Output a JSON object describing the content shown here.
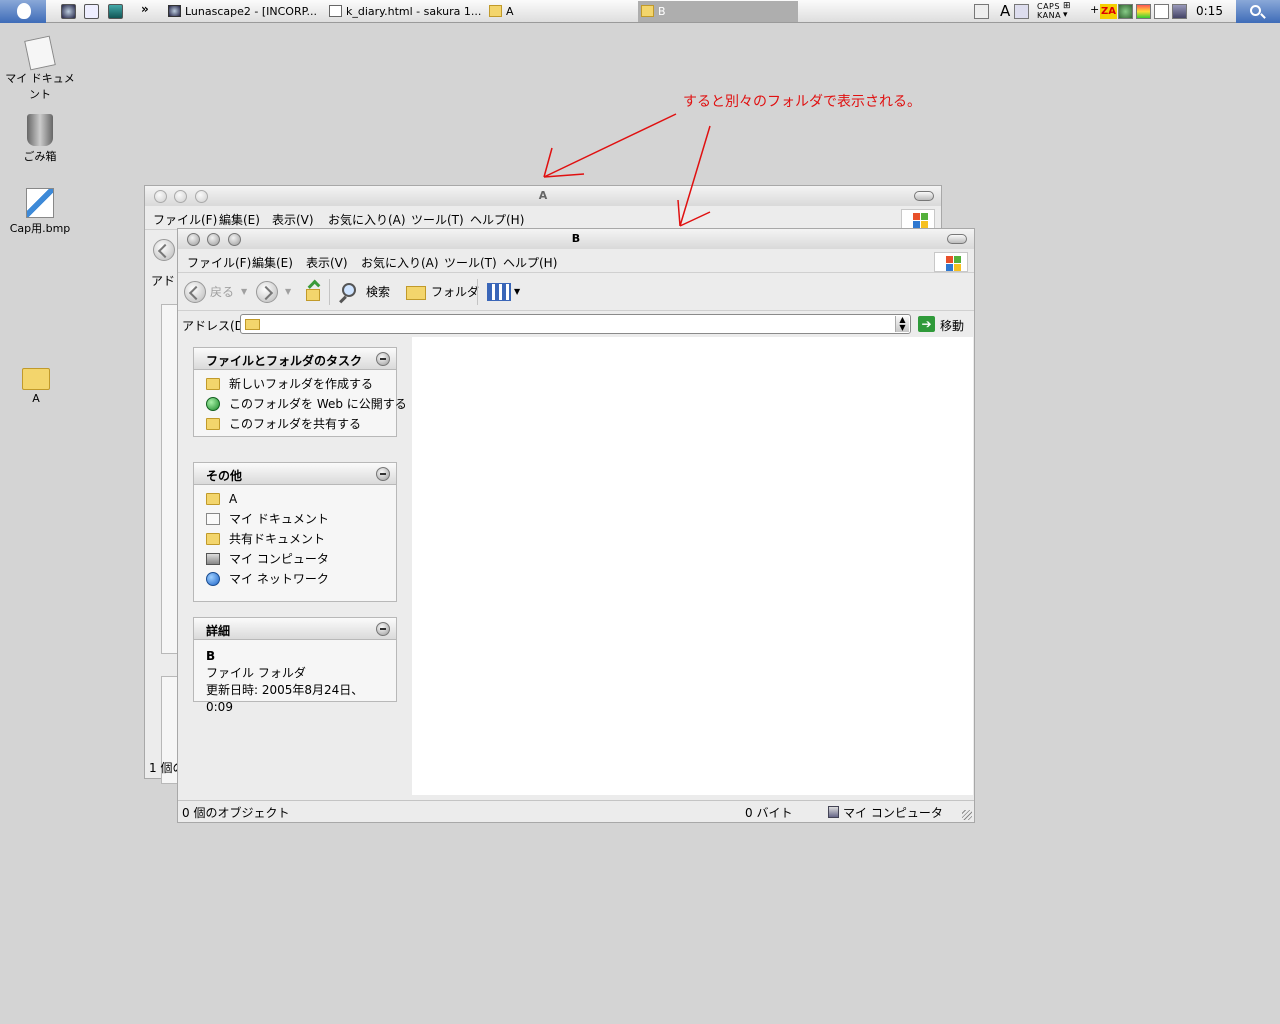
{
  "taskbar": {
    "more": "»",
    "tasks": [
      {
        "label": "Lunascape2 - [INCORP..."
      },
      {
        "label": "k_diary.html - sakura 1..."
      },
      {
        "label": "A"
      },
      {
        "label": "B"
      }
    ],
    "ime_a": "A",
    "caps": "CAPS",
    "kana": "KANA",
    "ime_za": "ZA",
    "clock": "0:15"
  },
  "desktop": {
    "icons": [
      {
        "label": "マイ ドキュメント",
        "icon": "my-documents-icon"
      },
      {
        "label": "ごみ箱",
        "icon": "recycle-bin-icon"
      },
      {
        "label": "Cap用.bmp",
        "icon": "paint-bitmap-icon"
      },
      {
        "label": "A",
        "icon": "folder-icon"
      }
    ]
  },
  "annotation": {
    "text": "すると別々のフォルダで表示される。",
    "color": "#e01010"
  },
  "window_a": {
    "title": "A",
    "menu": [
      "ファイル(F)",
      "編集(E)",
      "表示(V)",
      "お気に入り(A)",
      "ツール(T)",
      "ヘルプ(H)"
    ],
    "address_label": "アドレ",
    "status": "1 個の"
  },
  "window_b": {
    "title": "B",
    "menu": [
      "ファイル(F)",
      "編集(E)",
      "表示(V)",
      "お気に入り(A)",
      "ツール(T)",
      "ヘルプ(H)"
    ],
    "toolbar": {
      "back": "戻る",
      "search": "検索",
      "folders": "フォルダ"
    },
    "address": {
      "label": "アドレス(D)",
      "value": "",
      "go": "移動"
    },
    "tasks_panel": {
      "title": "ファイルとフォルダのタスク",
      "items": [
        {
          "label": "新しいフォルダを作成する"
        },
        {
          "label": "このフォルダを Web に公開する"
        },
        {
          "label": "このフォルダを共有する"
        }
      ]
    },
    "other_panel": {
      "title": "その他",
      "items": [
        {
          "label": "A"
        },
        {
          "label": "マイ ドキュメント"
        },
        {
          "label": "共有ドキュメント"
        },
        {
          "label": "マイ コンピュータ"
        },
        {
          "label": "マイ ネットワーク"
        }
      ]
    },
    "details_panel": {
      "title": "詳細",
      "name": "B",
      "type": "ファイル フォルダ",
      "modified": "更新日時: 2005年8月24日、0:09"
    },
    "status": {
      "objects": "0 個のオブジェクト",
      "size": "0 バイト",
      "location": "マイ コンピュータ"
    }
  }
}
